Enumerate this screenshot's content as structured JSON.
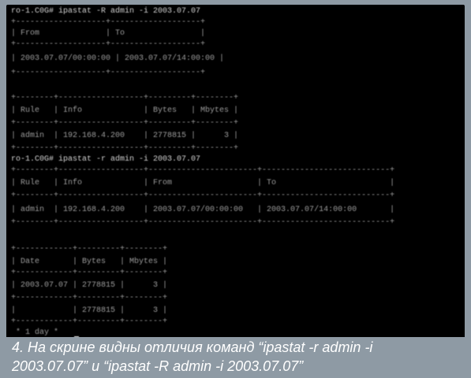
{
  "terminal": {
    "lines": [
      "ro-1.C0G# ipastat -R admin -i 2003.07.07",
      "+-------------------+-------------------+",
      "| From              | To                |",
      "+-------------------+-------------------+",
      "| 2003.07.07/00:00:00 | 2003.07.07/14:00:00 |",
      "+-------------------+-------------------+",
      "",
      "+--------+------------------+---------+--------+",
      "| Rule   | Info             | Bytes   | Mbytes |",
      "+--------+------------------+---------+--------+",
      "| admin  | 192.168.4.200    | 2778815 |      3 |",
      "+--------+------------------+---------+--------+",
      "ro-1.C0G# ipastat -r admin -i 2003.07.07",
      "+--------+------------------+-----------------------+---------------------------+",
      "| Rule   | Info             | From                  | To                        |",
      "+--------+------------------+-----------------------+---------------------------+",
      "| admin  | 192.168.4.200    | 2003.07.07/00:00:00   | 2003.07.07/14:00:00       |",
      "+--------+------------------+-----------------------+---------------------------+",
      "",
      "+------------+---------+--------+",
      "| Date       | Bytes   | Mbytes |",
      "+------------+---------+--------+",
      "| 2003.07.07 | 2778815 |      3 |",
      "+------------+---------+--------+",
      "|            | 2778815 |      3 |",
      "+------------+---------+--------+",
      " * 1 day *"
    ]
  },
  "caption": {
    "text": "4. На скрине видны отличия команд “ipastat -r admin -i\n2003.07.07” и “ipastat -R admin -i 2003.07.07”"
  }
}
